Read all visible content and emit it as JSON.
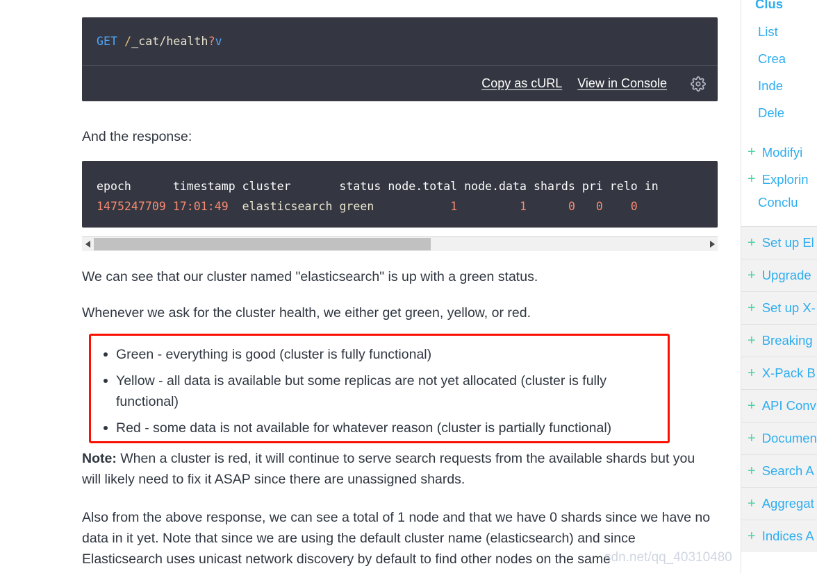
{
  "request_card": {
    "method": "GET",
    "slash1": "/",
    "path": "_cat/health",
    "question": "?",
    "param": "v",
    "toolbar": {
      "copy_curl_label": "Copy as cURL",
      "view_console_label": "View in Console",
      "settings_icon": "gear-icon"
    },
    "background_color": "#343741",
    "method_color": "#4fa6f8"
  },
  "response_intro": "And the response:",
  "response_card": {
    "header_line": "epoch      timestamp cluster       status node.total node.data shards pri relo in",
    "row": {
      "epoch": "1475247709",
      "timestamp": "17:01:49",
      "cluster": "elasticsearch",
      "status": "green",
      "node_total": "1",
      "node_data": "1",
      "shards": "0",
      "pri": "0",
      "relo": "0"
    },
    "header_columns": [
      "epoch",
      "timestamp",
      "cluster",
      "status",
      "node.total",
      "node.data",
      "shards",
      "pri",
      "relo",
      "in"
    ],
    "number_color": "#f98a71"
  },
  "scrollbar": {
    "left_arrow_icon": "triangle-left-icon",
    "right_arrow_icon": "triangle-right-icon",
    "thumb_color": "#c1c1c1"
  },
  "paragraphs": {
    "can_see": "We can see that our cluster named \"elasticsearch\" is up with a green status.",
    "whenever": "Whenever we ask for the cluster health, we either get green, yellow, or red.",
    "note_label": "Note:",
    "note_body": " When a cluster is red, it will continue to serve search requests from the available shards but you will likely need to fix it ASAP since there are unassigned shards.",
    "also": "Also from the above response, we can see a total of 1 node and that we have 0 shards since we have no data in it yet. Note that since we are using the default cluster name (elasticsearch) and since Elasticsearch uses unicast network discovery by default to find other nodes on the same"
  },
  "highlight_box": {
    "border_color": "#fa1000",
    "items": [
      "Green - everything is good (cluster is fully functional)",
      "Yellow - all data is available but some replicas are not yet allocated (cluster is fully functional)",
      "Red - some data is not available for whatever reason (cluster is partially functional)"
    ]
  },
  "sidebar": {
    "link_color": "#2eadef",
    "plus_color": "#4fd1a5",
    "sub_items": [
      {
        "label": "Clus",
        "bold": true
      },
      {
        "label": "List",
        "bold": false
      },
      {
        "label": "Crea",
        "bold": false
      },
      {
        "label": "Inde",
        "bold": false
      },
      {
        "label": "Dele",
        "bold": false
      }
    ],
    "mid_items": [
      {
        "label": "Modifyi",
        "plus": "+"
      },
      {
        "label": "Explorin",
        "plus": "+"
      }
    ],
    "conclusion": "Conclu",
    "groups": [
      {
        "plus": "+",
        "label": "Set up El"
      },
      {
        "plus": "+",
        "label": "Upgrade"
      },
      {
        "plus": "+",
        "label": "Set up X-"
      },
      {
        "plus": "+",
        "label": "Breaking"
      },
      {
        "plus": "+",
        "label": "X-Pack B"
      },
      {
        "plus": "+",
        "label": "API Conv"
      },
      {
        "plus": "+",
        "label": "Documen"
      },
      {
        "plus": "+",
        "label": "Search A"
      },
      {
        "plus": "+",
        "label": "Aggregat"
      },
      {
        "plus": "+",
        "label": "Indices A"
      }
    ]
  },
  "watermark": "sdn.net/qq_40310480"
}
